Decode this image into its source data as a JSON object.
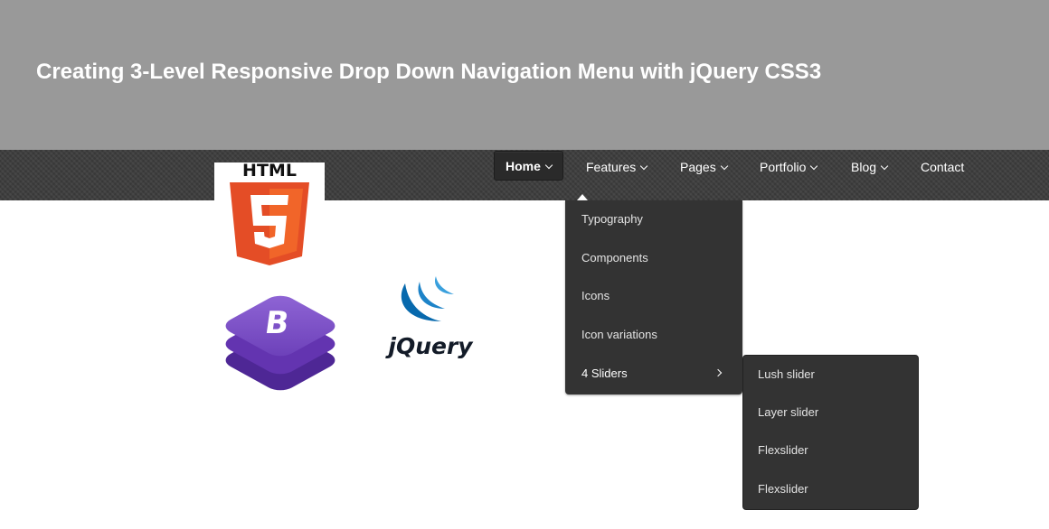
{
  "header": {
    "title": "Creating 3-Level Responsive Drop Down Navigation Menu with jQuery CSS3"
  },
  "nav": {
    "items": [
      {
        "label": "Home",
        "has_dropdown": true,
        "active": true
      },
      {
        "label": "Features",
        "has_dropdown": true
      },
      {
        "label": "Pages",
        "has_dropdown": true
      },
      {
        "label": "Portfolio",
        "has_dropdown": true
      },
      {
        "label": "Blog",
        "has_dropdown": true
      },
      {
        "label": "Contact",
        "has_dropdown": false
      }
    ]
  },
  "dropdown": {
    "items": [
      {
        "label": "Typography"
      },
      {
        "label": "Components"
      },
      {
        "label": "Icons"
      },
      {
        "label": "Icon variations"
      },
      {
        "label": "4 Sliders",
        "has_submenu": true
      }
    ]
  },
  "submenu": {
    "items": [
      {
        "label": "Lush slider"
      },
      {
        "label": "Layer slider"
      },
      {
        "label": "Flexslider"
      },
      {
        "label": "Flexslider"
      }
    ]
  },
  "logos": {
    "html5": {
      "text": "HTML",
      "digit": "5"
    },
    "bootstrap": {
      "letter": "B"
    },
    "jquery": {
      "text": "jQuery"
    }
  },
  "colors": {
    "header_bg": "#999999",
    "nav_bg": "#3c3c3c",
    "menu_bg": "#333333",
    "html5_orange": "#e44d26",
    "bootstrap_purple": "#7952b3",
    "jquery_blue": "#0769ad"
  }
}
